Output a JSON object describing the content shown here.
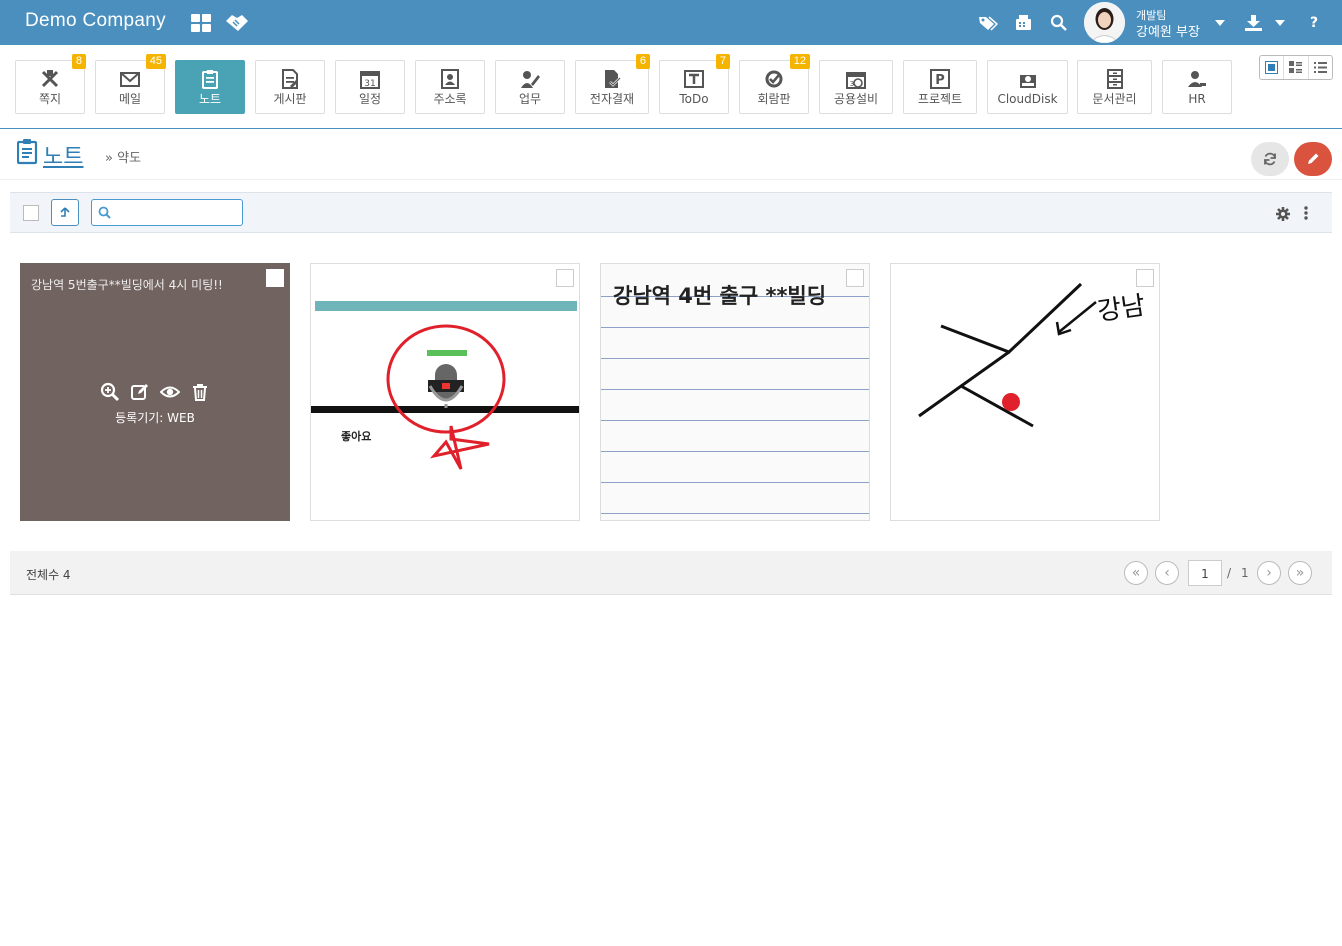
{
  "header": {
    "brand": "Demo Company",
    "user_dept": "개발팀",
    "user_name": "강예원 부장"
  },
  "modules": [
    {
      "label": "쪽지",
      "badge": "8",
      "icon": "note-message-icon"
    },
    {
      "label": "메일",
      "badge": "45",
      "icon": "mail-icon"
    },
    {
      "label": "노트",
      "badge": "",
      "icon": "notepad-icon",
      "active": true
    },
    {
      "label": "게시판",
      "badge": "",
      "icon": "board-icon"
    },
    {
      "label": "일정",
      "badge": "",
      "icon": "calendar-icon"
    },
    {
      "label": "주소록",
      "badge": "",
      "icon": "address-book-icon"
    },
    {
      "label": "업무",
      "badge": "",
      "icon": "task-icon"
    },
    {
      "label": "전자결재",
      "badge": "6",
      "icon": "approval-icon"
    },
    {
      "label": "ToDo",
      "badge": "7",
      "icon": "todo-icon"
    },
    {
      "label": "회람판",
      "badge": "12",
      "icon": "circular-icon"
    },
    {
      "label": "공용설비",
      "badge": "",
      "icon": "facility-icon"
    },
    {
      "label": "프로젝트",
      "badge": "",
      "icon": "project-icon"
    },
    {
      "label": "CloudDisk",
      "badge": "",
      "icon": "cloud-disk-icon"
    },
    {
      "label": "문서관리",
      "badge": "",
      "icon": "document-cabinet-icon"
    },
    {
      "label": "HR",
      "badge": "",
      "icon": "hr-person-icon"
    }
  ],
  "page": {
    "title": "노트",
    "breadcrumb_sep": "»",
    "breadcrumb": "약도"
  },
  "toolbar": {
    "search_placeholder": ""
  },
  "cards": [
    {
      "text": "강남역 5번출구**빌딩에서 4시 미팅!!",
      "device": "등록기기: WEB"
    },
    {
      "caption": "좋아요"
    },
    {
      "text": "강남역 4번 출구 **빌딩"
    },
    {
      "text": "강남"
    }
  ],
  "footer": {
    "total": "전체수 4",
    "page": "1",
    "sep": "/",
    "pages": "1"
  },
  "colors": {
    "topbar": "#4a8fbe",
    "active_module": "#4aa3b4",
    "badge": "#f5b400",
    "note_card": "#716360",
    "edit_button": "#d9533f"
  }
}
